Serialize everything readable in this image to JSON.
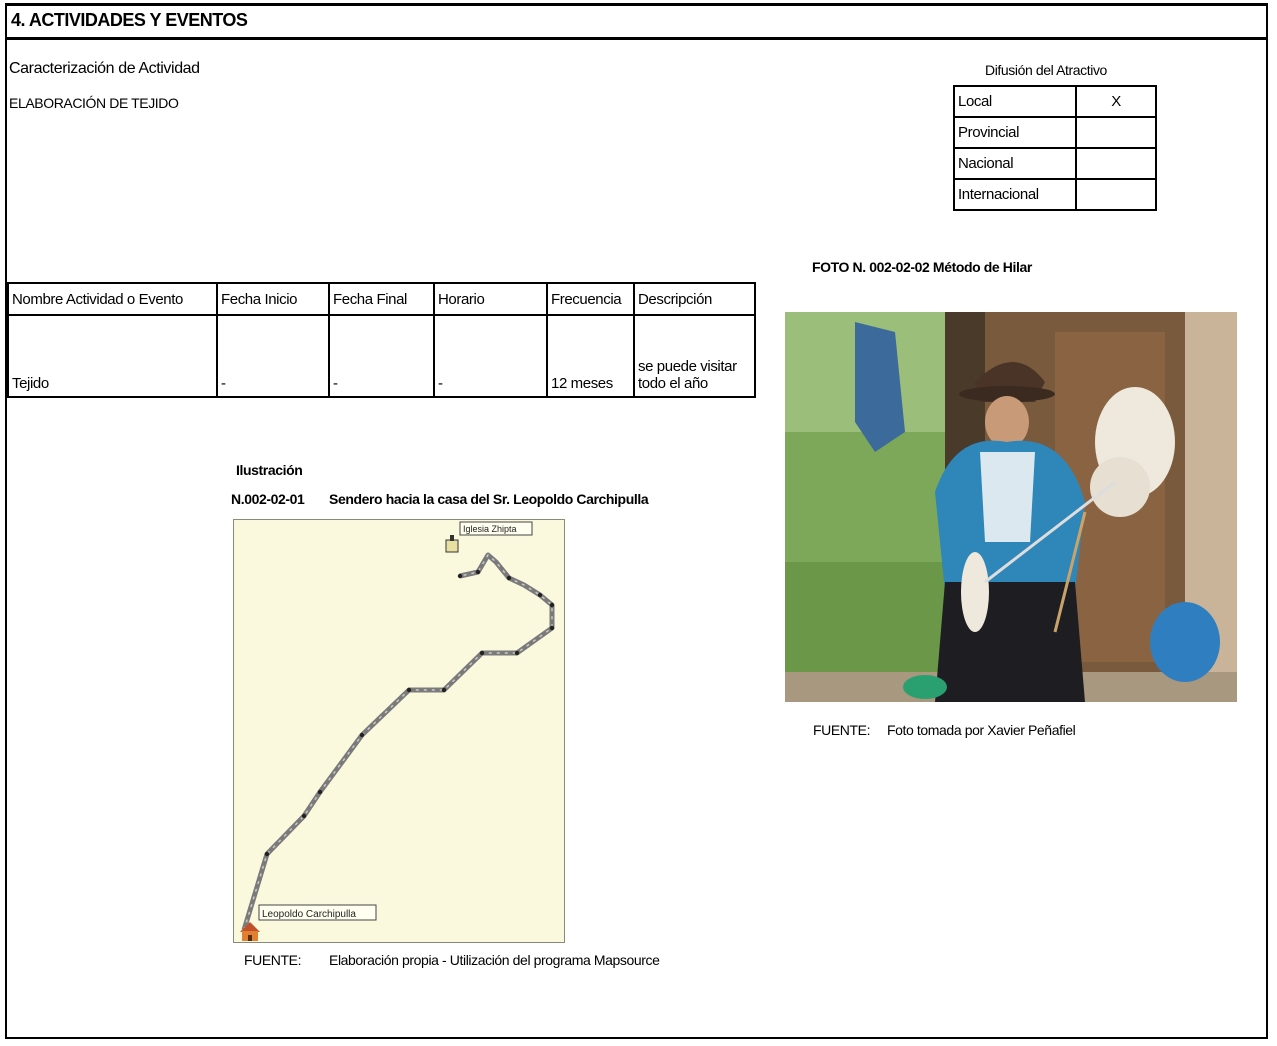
{
  "section": {
    "title": "4. ACTIVIDADES Y EVENTOS"
  },
  "caracterizacion": {
    "label": "Caracterización de Actividad",
    "value": "ELABORACIÓN DE TEJIDO"
  },
  "difusion": {
    "title": "Difusión del Atractivo",
    "rows": [
      {
        "label": "Local",
        "mark": "X"
      },
      {
        "label": "Provincial",
        "mark": ""
      },
      {
        "label": "Nacional",
        "mark": ""
      },
      {
        "label": "Internacional",
        "mark": ""
      }
    ]
  },
  "actividades": {
    "headers": [
      "Nombre Actividad o Evento",
      "Fecha Inicio",
      "Fecha Final",
      "Horario",
      "Frecuencia",
      "Descripción"
    ],
    "rows": [
      {
        "nombre": "Tejido",
        "inicio": "-",
        "final": "-",
        "horario": "-",
        "frecuencia": "12 meses",
        "descripcion_1": "se puede visitar",
        "descripcion_2": "todo el año"
      }
    ]
  },
  "ilustracion": {
    "label": "Ilustración",
    "number": "N.002-02-01",
    "caption": "Sendero hacia la casa del Sr. Leopoldo Carchipulla",
    "map_label_start": "Leopoldo Carchipulla",
    "map_label_end": "Iglesia Zhipta",
    "fuente_label": "FUENTE:",
    "fuente_value": "Elaboración propia - Utilización del programa Mapsource"
  },
  "foto": {
    "caption": "FOTO N. 002-02-02 Método de Hilar",
    "fuente_label": "FUENTE:",
    "fuente_value": "Foto tomada por Xavier Peñafiel"
  },
  "colors": {
    "map_background": "#fbf9dd",
    "route": "#7a7a7a"
  }
}
